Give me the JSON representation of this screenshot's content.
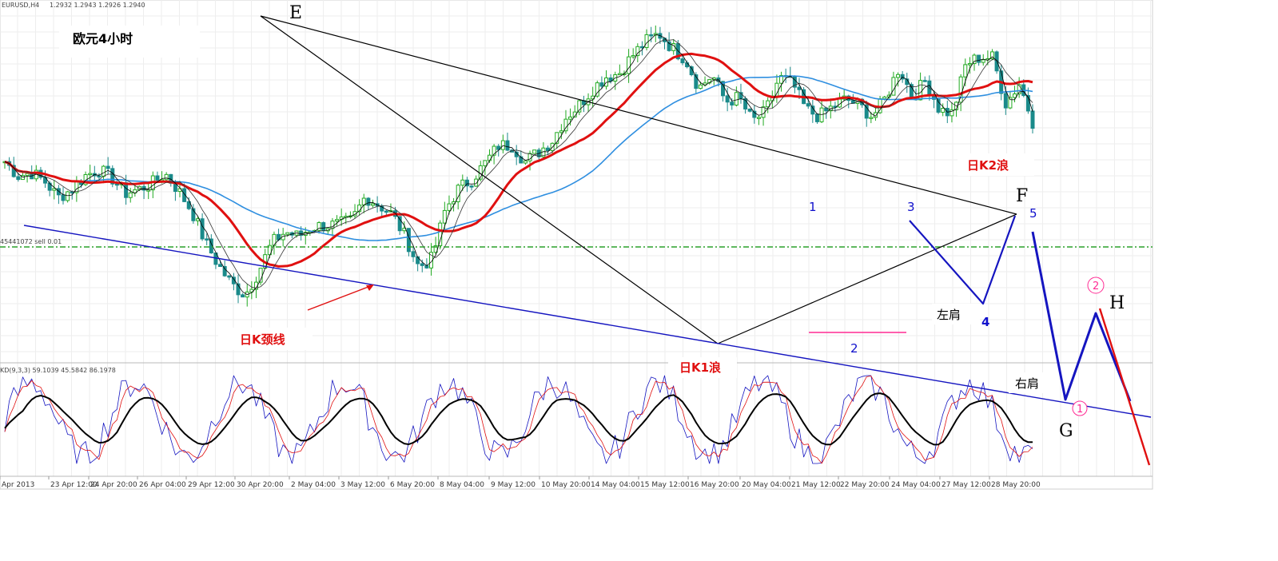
{
  "header": {
    "symbol": "EURUSD,H4",
    "ohlc": "1.2932 1.2943 1.2926 1.2940"
  },
  "title": "欧元4小时",
  "level_label": "45441072 sell 0.01",
  "indicator_header": "KD(9,3,3) 59.1039 45.5842 86.1978",
  "annotations": {
    "E": "E",
    "F": "F",
    "G": "G",
    "H": "H",
    "daily_k1": "日K1浪",
    "daily_k2": "日K2浪",
    "neckline": "日K颈线",
    "left_shoulder": "左肩",
    "right_shoulder": "右肩",
    "wave_nums": [
      "1",
      "2",
      "3",
      "4",
      "5"
    ],
    "circle_1": "1",
    "circle_2": "2"
  },
  "time_labels": [
    "Apr 2013",
    "23 Apr 12:00",
    "24 Apr 20:00",
    "26 Apr 04:00",
    "29 Apr 12:00",
    "30 Apr 20:00",
    "2 May 04:00",
    "3 May 12:00",
    "6 May 20:00",
    "8 May 04:00",
    "9 May 12:00",
    "10 May 20:00",
    "14 May 04:00",
    "15 May 12:00",
    "16 May 20:00",
    "20 May 04:00",
    "21 May 12:00",
    "22 May 20:00",
    "24 May 04:00",
    "27 May 12:00",
    "28 May 20:00"
  ],
  "colors": {
    "bull": "#22aa22",
    "bear": "#1a8a8a",
    "ma_fast": "#000000",
    "ma_red": "#e01010",
    "ma_blue": "#2f8fe0",
    "neckline": "#1515c0",
    "level": "#2aa02a",
    "pink": "#ff2c94",
    "stoch_k": "#1515c0",
    "stoch_d": "#e01010",
    "stoch_slow": "#000000"
  },
  "chart_data": {
    "type": "candlestick",
    "symbol": "EURUSD",
    "timeframe": "H4",
    "x": [
      "Apr 2013",
      "23 Apr 12:00",
      "24 Apr 20:00",
      "26 Apr 04:00",
      "29 Apr 12:00",
      "30 Apr 20:00",
      "2 May 04:00",
      "3 May 12:00",
      "6 May 20:00",
      "8 May 04:00",
      "9 May 12:00",
      "10 May 20:00",
      "14 May 04:00",
      "15 May 12:00",
      "16 May 20:00",
      "20 May 04:00",
      "21 May 12:00",
      "22 May 20:00",
      "24 May 04:00",
      "27 May 12:00",
      "28 May 20:00"
    ],
    "close_trace": [
      250,
      232,
      236,
      225,
      205,
      215,
      232,
      240,
      230,
      210,
      215,
      222,
      235,
      214,
      188,
      150,
      120,
      96,
      83,
      112,
      148,
      162,
      156,
      168,
      170,
      171,
      176,
      206,
      196,
      184,
      156,
      118,
      128,
      190,
      216,
      228,
      248,
      270,
      270,
      250,
      262,
      276,
      305,
      320,
      340,
      356,
      360,
      382,
      400,
      410,
      392,
      378,
      342,
      358,
      325,
      330,
      300,
      312,
      355,
      348,
      315,
      306,
      318,
      328,
      320,
      306,
      330,
      368,
      330,
      352,
      315,
      310,
      372,
      380,
      380,
      322,
      348,
      300
    ],
    "markers": {
      "wave_points": [
        {
          "label": "E",
          "pos": 0.225
        },
        {
          "label": "F",
          "pos": 0.876
        },
        {
          "label": "G",
          "pos": 0.923
        },
        {
          "label": "H",
          "pos": 0.952
        }
      ]
    },
    "indicators": [
      "MA fast",
      "MA slow",
      "MA red",
      "MA blue",
      "Stochastic KD(9,3,3)"
    ]
  }
}
